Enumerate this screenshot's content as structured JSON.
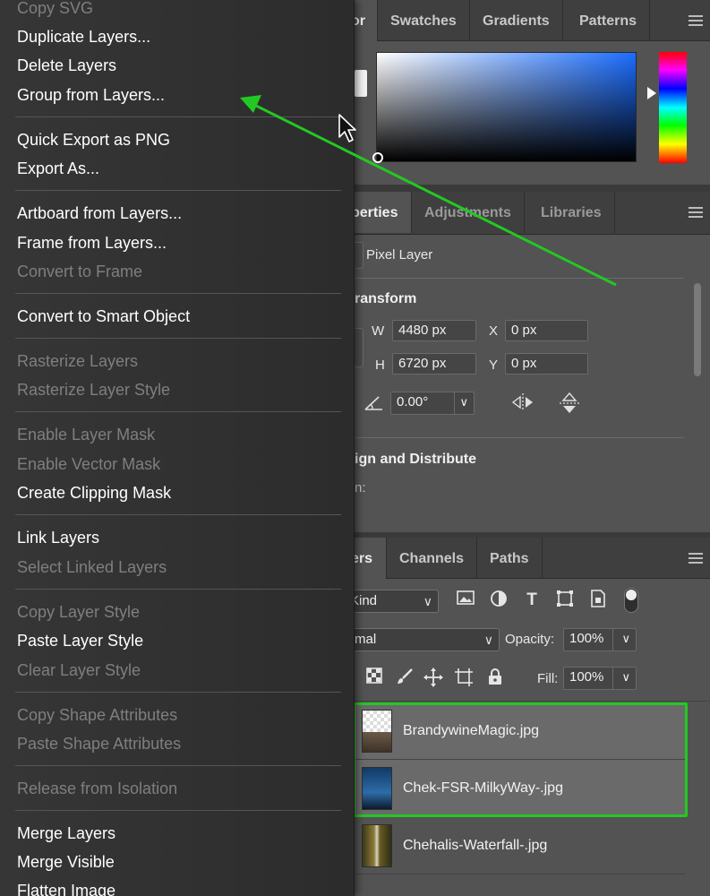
{
  "menu": {
    "items": [
      {
        "label": "Copy SVG",
        "enabled": false
      },
      {
        "label": "Duplicate Layers...",
        "enabled": true
      },
      {
        "label": "Delete Layers",
        "enabled": true
      },
      {
        "label": "Group from Layers...",
        "enabled": true
      },
      {
        "label": "Quick Export as PNG",
        "enabled": true
      },
      {
        "label": "Export As...",
        "enabled": true
      },
      {
        "label": "Artboard from Layers...",
        "enabled": true
      },
      {
        "label": "Frame from Layers...",
        "enabled": true
      },
      {
        "label": "Convert to Frame",
        "enabled": false
      },
      {
        "label": "Convert to Smart Object",
        "enabled": true
      },
      {
        "label": "Rasterize Layers",
        "enabled": false
      },
      {
        "label": "Rasterize Layer Style",
        "enabled": false
      },
      {
        "label": "Enable Layer Mask",
        "enabled": false
      },
      {
        "label": "Enable Vector Mask",
        "enabled": false
      },
      {
        "label": "Create Clipping Mask",
        "enabled": true
      },
      {
        "label": "Link Layers",
        "enabled": true
      },
      {
        "label": "Select Linked Layers",
        "enabled": false
      },
      {
        "label": "Copy Layer Style",
        "enabled": false
      },
      {
        "label": "Paste Layer Style",
        "enabled": true
      },
      {
        "label": "Clear Layer Style",
        "enabled": false
      },
      {
        "label": "Copy Shape Attributes",
        "enabled": false
      },
      {
        "label": "Paste Shape Attributes",
        "enabled": false
      },
      {
        "label": "Release from Isolation",
        "enabled": false
      },
      {
        "label": "Merge Layers",
        "enabled": true
      },
      {
        "label": "Merge Visible",
        "enabled": true
      },
      {
        "label": "Flatten Image",
        "enabled": true
      }
    ]
  },
  "color_panel": {
    "tabs": [
      "or",
      "Swatches",
      "Gradients",
      "Patterns"
    ]
  },
  "properties_panel": {
    "tabs": [
      "perties",
      "Adjustments",
      "Libraries"
    ],
    "layer_type": "Pixel Layer",
    "transform_heading": "ransform",
    "w_label": "W",
    "w_value": "4480 px",
    "h_label": "H",
    "h_value": "6720 px",
    "x_label": "X",
    "x_value": "0 px",
    "y_label": "Y",
    "y_value": "0 px",
    "angle_value": "0.00°",
    "align_heading": "ign and Distribute",
    "align_sub": "n:"
  },
  "layers_panel": {
    "tabs": [
      "ers",
      "Channels",
      "Paths"
    ],
    "filter_kind": "Kind",
    "blend_mode": "rmal",
    "opacity_label": "Opacity:",
    "opacity_value": "100%",
    "fill_label": "Fill:",
    "fill_value": "100%",
    "layers": [
      {
        "name": "BrandywineMagic.jpg",
        "selected": true
      },
      {
        "name": "Chek-FSR-MilkyWay-.jpg",
        "selected": true
      },
      {
        "name": "Chehalis-Waterfall-.jpg",
        "selected": false
      }
    ]
  },
  "colors": {
    "highlight_green": "#22c922",
    "menu_bg": "#313131",
    "panel_bg": "#535353"
  }
}
